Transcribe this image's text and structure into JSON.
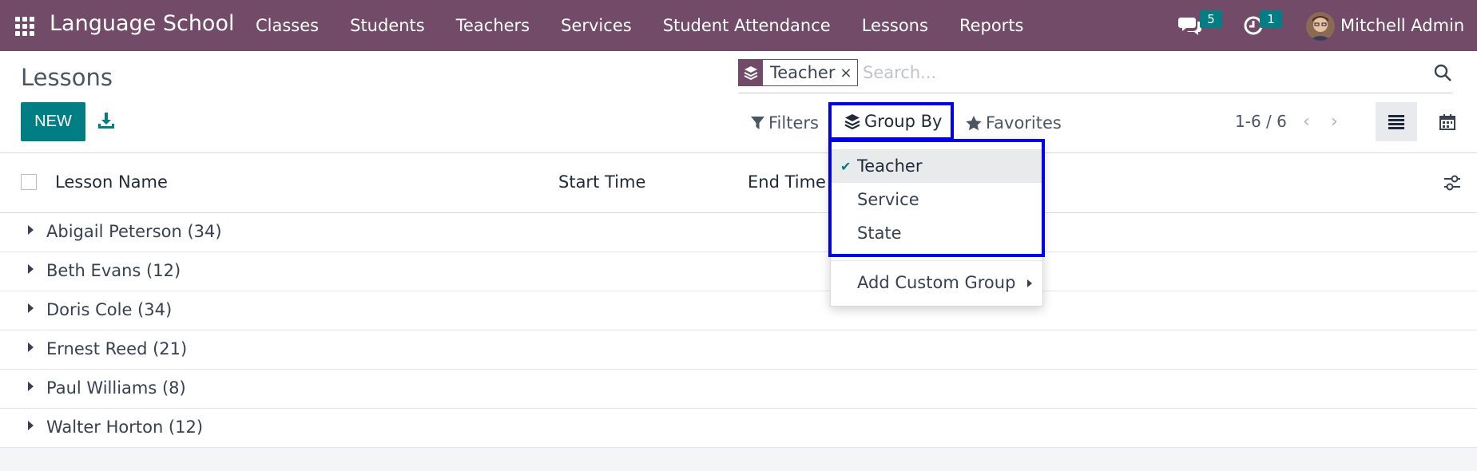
{
  "navbar": {
    "app_title": "Language School",
    "menu": [
      "Classes",
      "Students",
      "Teachers",
      "Services",
      "Student Attendance",
      "Lessons",
      "Reports"
    ],
    "chat_count": "5",
    "activity_count": "1",
    "user_name": "Mitchell Admin"
  },
  "control_panel": {
    "page_title": "Lessons",
    "new_label": "NEW",
    "facet_label": "Teacher",
    "facet_close": "×",
    "search_placeholder": "Search...",
    "filters_label": "Filters",
    "groupby_label": "Group By",
    "favorites_label": "Favorites",
    "pager": "1-6 / 6"
  },
  "list": {
    "columns": [
      "Lesson Name",
      "Start Time",
      "End Time"
    ],
    "groups": [
      "Abigail Peterson (34)",
      "Beth Evans (12)",
      "Doris Cole (34)",
      "Ernest Reed (21)",
      "Paul Williams (8)",
      "Walter Horton (12)"
    ]
  },
  "groupby_dropdown": {
    "options": [
      "Teacher",
      "Service",
      "State"
    ],
    "selected": "Teacher",
    "add_custom_group": "Add Custom Group"
  },
  "colors": {
    "navbar": "#714B67",
    "primary": "#017e84",
    "highlight": "#0000e6"
  }
}
